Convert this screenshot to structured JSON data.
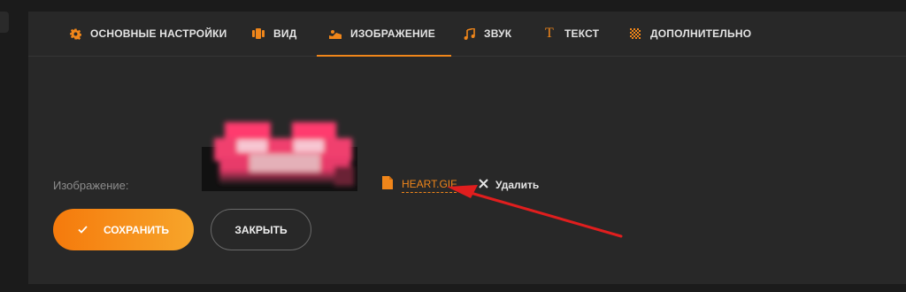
{
  "tabs": [
    {
      "label": "ОСНОВНЫЕ НАСТРОЙКИ",
      "icon": "gear-icon"
    },
    {
      "label": "ВИД",
      "icon": "view-icon"
    },
    {
      "label": "ИЗОБРАЖЕНИЕ",
      "icon": "image-icon",
      "active": true
    },
    {
      "label": "ЗВУК",
      "icon": "music-icon"
    },
    {
      "label": "ТЕКСТ",
      "icon": "text-icon"
    },
    {
      "label": "ДОПОЛНИТЕЛЬНО",
      "icon": "checker-icon"
    }
  ],
  "image_field": {
    "label": "Изображение:",
    "file_name": "HEART.GIF",
    "delete_label": "Удалить"
  },
  "actions": {
    "save_label": "СОХРАНИТЬ",
    "close_label": "ЗАКРЫТЬ"
  },
  "colors": {
    "accent": "#f0861a",
    "annotation_arrow": "#e01e1e",
    "panel_bg": "#282828"
  }
}
